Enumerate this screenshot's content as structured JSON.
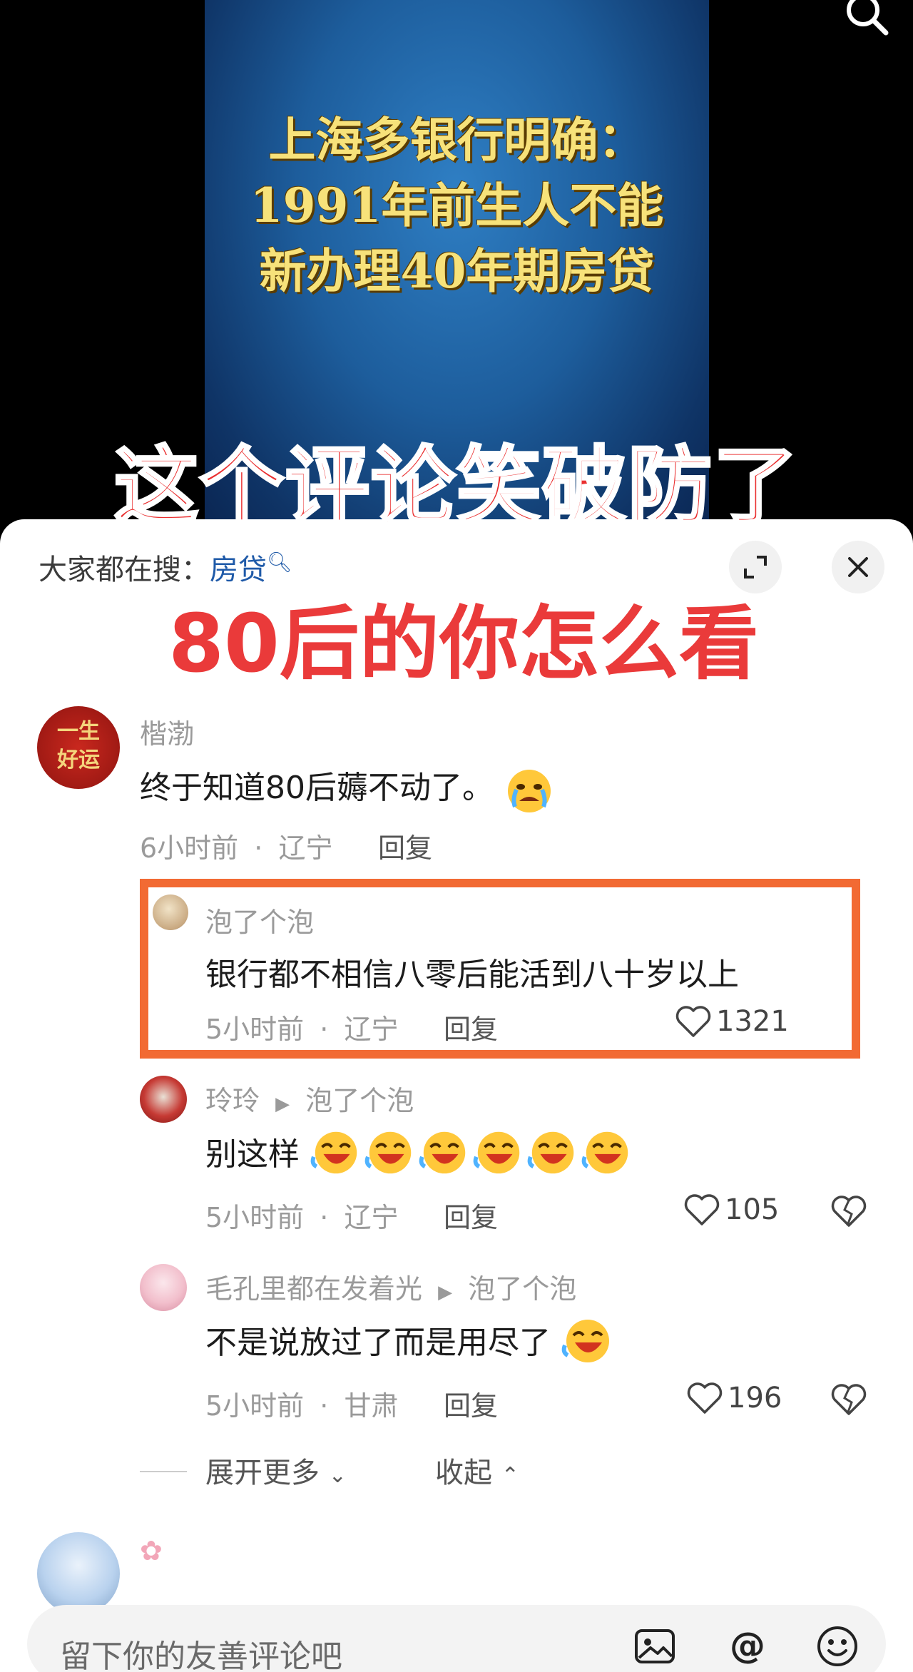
{
  "video": {
    "title_lines": [
      "上海多银行明确：",
      "1991年前生人不能",
      "新办理40年期房贷"
    ]
  },
  "overlay": {
    "line1": "这个评论笑破防了",
    "line2": "80后的你怎么看"
  },
  "sheet": {
    "trend_label": "大家都在搜：",
    "trend_keyword": "房贷"
  },
  "comments": [
    {
      "name": "楷渤",
      "avatar_text": "一生好运",
      "text": "终于知道80后薅不动了。",
      "time": "6小时前",
      "location": "辽宁",
      "reply_label": "回复",
      "emoji": "crying-face"
    },
    {
      "name": "泡了个泡",
      "text": "银行都不相信八零后能活到八十岁以上",
      "time": "5小时前",
      "location": "辽宁",
      "reply_label": "回复",
      "likes": "1321"
    },
    {
      "name": "玲玲",
      "reply_to": "泡了个泡",
      "text": "别这样",
      "time": "5小时前",
      "location": "辽宁",
      "reply_label": "回复",
      "likes": "105",
      "emoji_count": 6
    },
    {
      "name": "毛孔里都在发着光",
      "reply_to": "泡了个泡",
      "text": "不是说放过了而是用尽了",
      "time": "5小时前",
      "location": "甘肃",
      "reply_label": "回复",
      "likes": "196"
    }
  ],
  "thread_controls": {
    "expand_more": "展开更多",
    "collapse": "收起"
  },
  "input": {
    "placeholder": "留下你的友善评论吧"
  },
  "meta_separator": "·",
  "colors": {
    "highlight": "#f26a33",
    "overlay_red": "#ea2f2f",
    "keyword_blue": "#1f5aa8",
    "title_yellow": "#f7e27a"
  }
}
